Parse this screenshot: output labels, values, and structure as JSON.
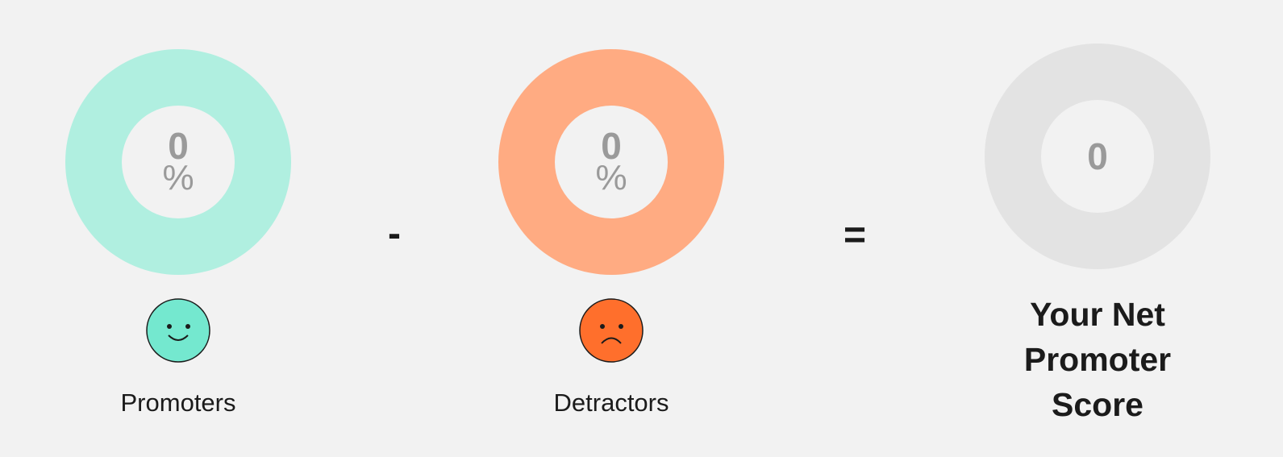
{
  "colors": {
    "background": "#f2f2f2",
    "promoter_ring": "#b0efe0",
    "promoter_face": "#74e8cf",
    "detractor_ring": "#ffab82",
    "detractor_face": "#ff6f2c",
    "score_ring": "#e3e3e3",
    "value_text": "#9a9a9a"
  },
  "promoters": {
    "value": "0",
    "unit": "%",
    "label": "Promoters",
    "icon": "smiley-happy-icon"
  },
  "operator_minus": "-",
  "detractors": {
    "value": "0",
    "unit": "%",
    "label": "Detractors",
    "icon": "smiley-sad-icon"
  },
  "operator_equals": "=",
  "score": {
    "value": "0",
    "title": "Your Net Promoter Score"
  }
}
